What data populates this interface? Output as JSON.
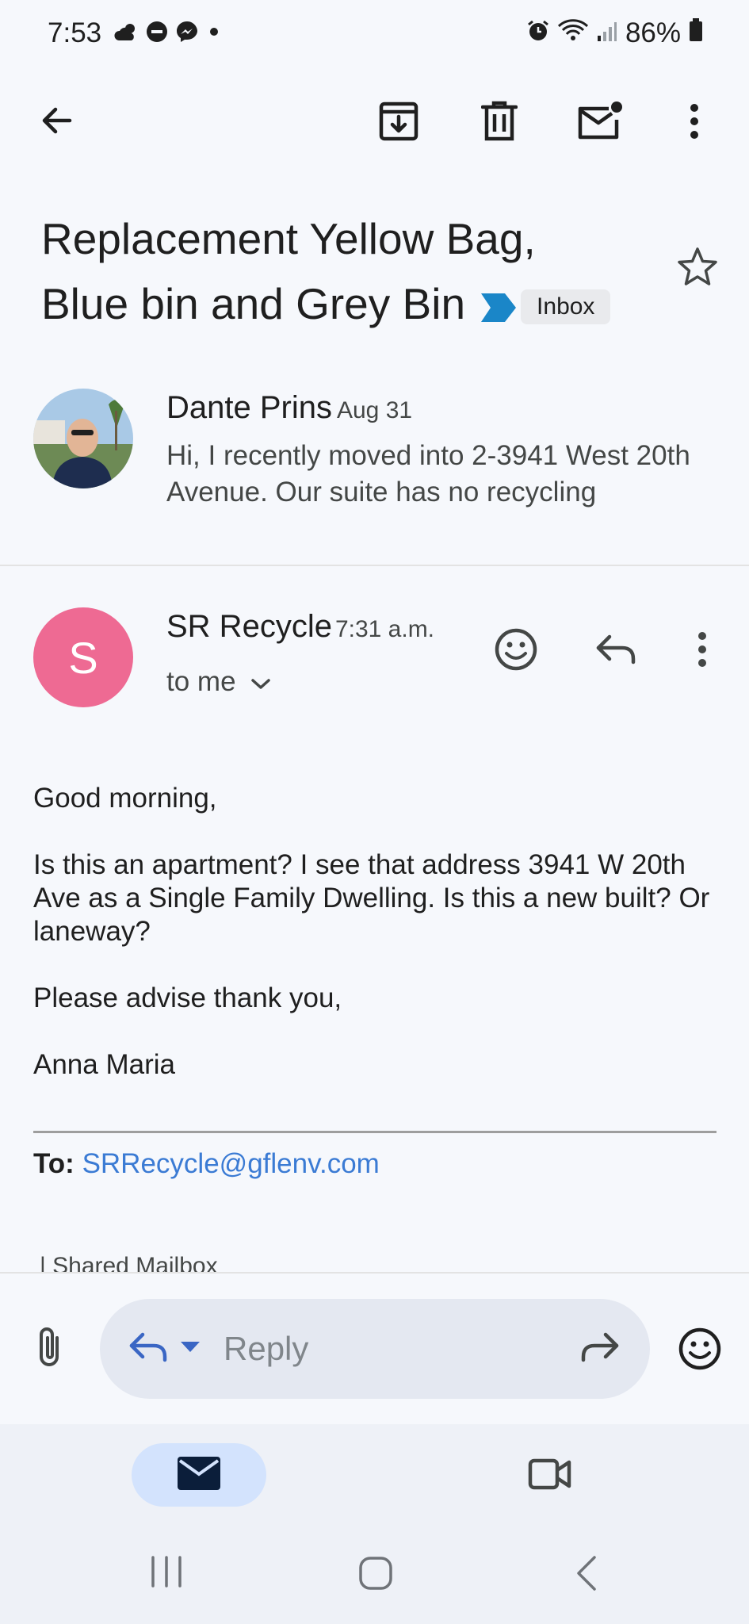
{
  "status_bar": {
    "time": "7:53",
    "battery": "86%"
  },
  "top_bar": {
    "icons": [
      "back-arrow-icon",
      "archive-icon",
      "delete-icon",
      "mark-unread-icon",
      "more-vert-icon"
    ]
  },
  "subject": {
    "line1": "Replacement Yellow Bag,",
    "line2": "Blue bin and Grey Bin",
    "label": "Inbox"
  },
  "thread": {
    "collapsed_message": {
      "sender": "Dante Prins",
      "date": "Aug 31",
      "snippet": "Hi, I recently moved into 2-3941 West 20th Avenue. Our suite has no recycling"
    },
    "expanded_message": {
      "avatar_letter": "S",
      "sender": "SR Recycle",
      "time": "7:31 a.m.",
      "recipient": "to me",
      "body": [
        "Good morning,",
        "Is this an apartment? I see that address 3941 W 20th Ave as a Single Family Dwelling. Is this a new built? Or laneway?",
        "Please advise thank you,",
        "Anna Maria"
      ],
      "to_label": "To:",
      "to_address": "SRRecycle@gflenv.com",
      "shared_mailbox": "| Shared Mailbox"
    }
  },
  "reply_bar": {
    "placeholder": "Reply"
  },
  "colors": {
    "background": "#f6f8fc",
    "avatar_s": "#ee6a93",
    "link": "#3b7bd4",
    "label_arrow": "#1a86c8",
    "nav_pill": "#d3e3fd"
  }
}
